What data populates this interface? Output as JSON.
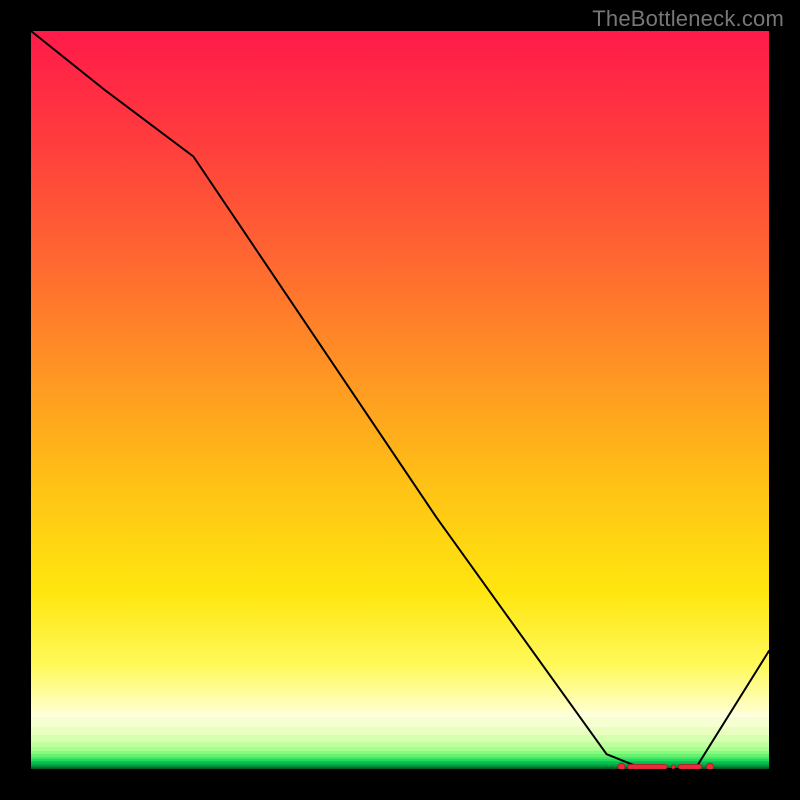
{
  "watermark": "TheBottleneck.com",
  "chart_data": {
    "type": "line",
    "title": "",
    "xlabel": "",
    "ylabel": "",
    "xlim": [
      0,
      100
    ],
    "ylim": [
      0,
      100
    ],
    "grid": false,
    "series": [
      {
        "name": "bottleneck-curve",
        "x": [
          0,
          10,
          22,
          55,
          78,
          83,
          90,
          100
        ],
        "y": [
          100,
          92,
          83,
          34,
          2,
          0,
          0,
          16
        ]
      }
    ],
    "minimum_segment": {
      "x_start": 80,
      "x_end": 92,
      "y": 0.3
    },
    "gradient_bands": [
      {
        "from": 0,
        "to": 93,
        "colors": [
          "#ff1a4a",
          "#ff3a3e",
          "#ff6a30",
          "#ff9a22",
          "#ffc315",
          "#ffe60f",
          "#fff95a",
          "#ffffc8",
          "#ffffe8"
        ]
      },
      {
        "from": 93,
        "to": 94.3,
        "color": "#f5ffd2"
      },
      {
        "from": 94.3,
        "to": 95.4,
        "color": "#e8ffc0"
      },
      {
        "from": 95.4,
        "to": 96.3,
        "color": "#d6ffb0"
      },
      {
        "from": 96.3,
        "to": 97.0,
        "color": "#c0ff9e"
      },
      {
        "from": 97.0,
        "to": 97.55,
        "color": "#a6ff8e"
      },
      {
        "from": 97.55,
        "to": 98.0,
        "color": "#88fb7e"
      },
      {
        "from": 98.0,
        "to": 98.35,
        "color": "#66f270"
      },
      {
        "from": 98.35,
        "to": 98.65,
        "color": "#40e866"
      },
      {
        "from": 98.65,
        "to": 98.9,
        "color": "#1edc5e"
      },
      {
        "from": 98.9,
        "to": 99.1,
        "color": "#0acc56"
      },
      {
        "from": 99.1,
        "to": 99.27,
        "color": "#03bd4e"
      },
      {
        "from": 99.27,
        "to": 99.42,
        "color": "#02ad46"
      },
      {
        "from": 99.42,
        "to": 99.55,
        "color": "#029d3f"
      },
      {
        "from": 99.55,
        "to": 99.67,
        "color": "#028d38"
      },
      {
        "from": 99.67,
        "to": 99.78,
        "color": "#027d31"
      },
      {
        "from": 99.78,
        "to": 99.88,
        "color": "#026d2a"
      },
      {
        "from": 99.88,
        "to": 100,
        "color": "#025d24"
      }
    ]
  },
  "plot": {
    "inner_w": 738,
    "inner_h": 738
  }
}
